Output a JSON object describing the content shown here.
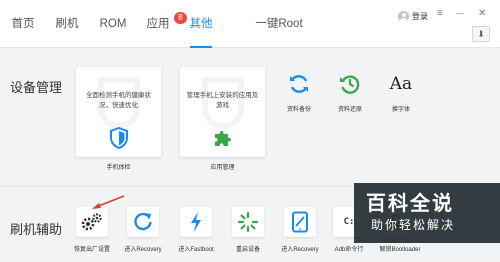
{
  "nav": {
    "tabs": [
      {
        "label": "首页"
      },
      {
        "label": "刷机"
      },
      {
        "label": "ROM"
      },
      {
        "label": "应用",
        "badge": "8"
      },
      {
        "label": "其他",
        "active": true
      },
      {
        "label": "一键Root"
      }
    ],
    "login_label": "登录",
    "menu_glyph": "≡",
    "minimize_glyph": "—",
    "close_glyph": "✕",
    "download_glyph": "⬇"
  },
  "device_mgmt": {
    "title": "设备管理",
    "cards": [
      {
        "desc": "全面检测手机的健康状况，快速优化",
        "caption": "手机体检",
        "icon": "shield-icon"
      },
      {
        "desc": "管理手机上安装的应用及游戏",
        "caption": "应用管理",
        "icon": "puzzle-icon"
      }
    ],
    "tools": [
      {
        "label": "资料备份",
        "icon": "sync-backup-icon"
      },
      {
        "label": "资料还原",
        "icon": "clock-restore-icon"
      },
      {
        "label": "换字体",
        "icon": "font-icon",
        "glyph": "Aa"
      }
    ]
  },
  "flash_assist": {
    "title": "刷机辅助",
    "tools": [
      {
        "label": "恢复出厂设置",
        "icon": "gears-icon"
      },
      {
        "label": "进入Recovery",
        "icon": "refresh-icon"
      },
      {
        "label": "进入Fastboot",
        "icon": "lightning-icon"
      },
      {
        "label": "重启设备",
        "icon": "spinner-icon"
      },
      {
        "label": "进入Recovery",
        "icon": "tablet-icon"
      },
      {
        "label": "Adb命令行",
        "icon": "terminal-icon",
        "glyph": "C:"
      },
      {
        "label": "解锁Bootloader",
        "icon": "unlock-icon"
      }
    ]
  },
  "watermark": {
    "line1": "百科全说",
    "line2": "助你轻松解决"
  },
  "colors": {
    "accent": "#1a8cf0",
    "badge": "#f04a3c",
    "green": "#3aa84a"
  }
}
